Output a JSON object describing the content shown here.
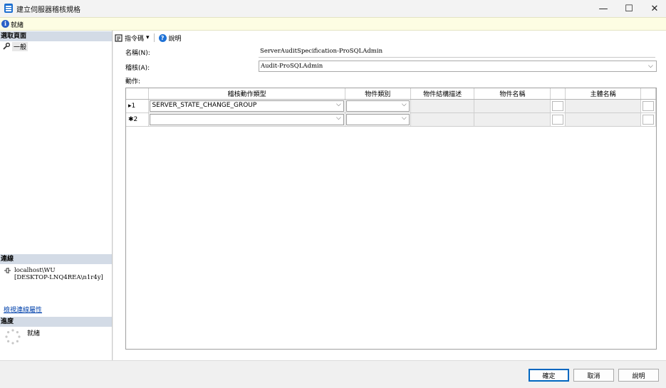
{
  "window": {
    "title": "建立伺服器稽核規格",
    "minimize_glyph": "—",
    "maximize_glyph": "☐",
    "close_glyph": "✕"
  },
  "status": {
    "text": "就緒",
    "icon": "info-icon"
  },
  "left_panel": {
    "select_page_header": "選取頁面",
    "pages": [
      {
        "label": "一般",
        "icon": "wrench-icon"
      }
    ],
    "connection_header": "連線",
    "connection_icon": "connection-plug-icon",
    "connection_line1": "localhost\\WU",
    "connection_line2": "[DESKTOP-LNQ4REA\\n1r4y]",
    "view_connection_link": "檢視連線屬性",
    "progress_header": "進度",
    "progress_text": "就緒"
  },
  "toolbar": {
    "script_label": "指令碼",
    "script_dropdown": "▾",
    "help_label": "說明"
  },
  "form": {
    "name_label": "名稱(N):",
    "name_value": "ServerAuditSpecification-ProSQLAdmin",
    "audit_label": "稽核(A):",
    "audit_value": "Audit-ProSQLAdmin",
    "actions_label": "動作:"
  },
  "grid": {
    "columns": [
      "",
      "稽核動作類型",
      "物件類別",
      "物件結構描述",
      "物件名稱",
      "",
      "主體名稱",
      ""
    ],
    "rows": [
      {
        "marker": "▸1",
        "action_type": "SERVER_STATE_CHANGE_GROUP",
        "object_class": ""
      },
      {
        "marker": "✱2",
        "action_type": "",
        "object_class": ""
      }
    ],
    "dropdown_glyph": "⌵"
  },
  "footer": {
    "ok_label": "確定",
    "cancel_label": "取消",
    "help_label": "說明"
  },
  "colors": {
    "header_band": "#d3dbe6",
    "status_background": "#fdfde3",
    "primary_border": "#0067c0",
    "link": "#0645ad"
  }
}
